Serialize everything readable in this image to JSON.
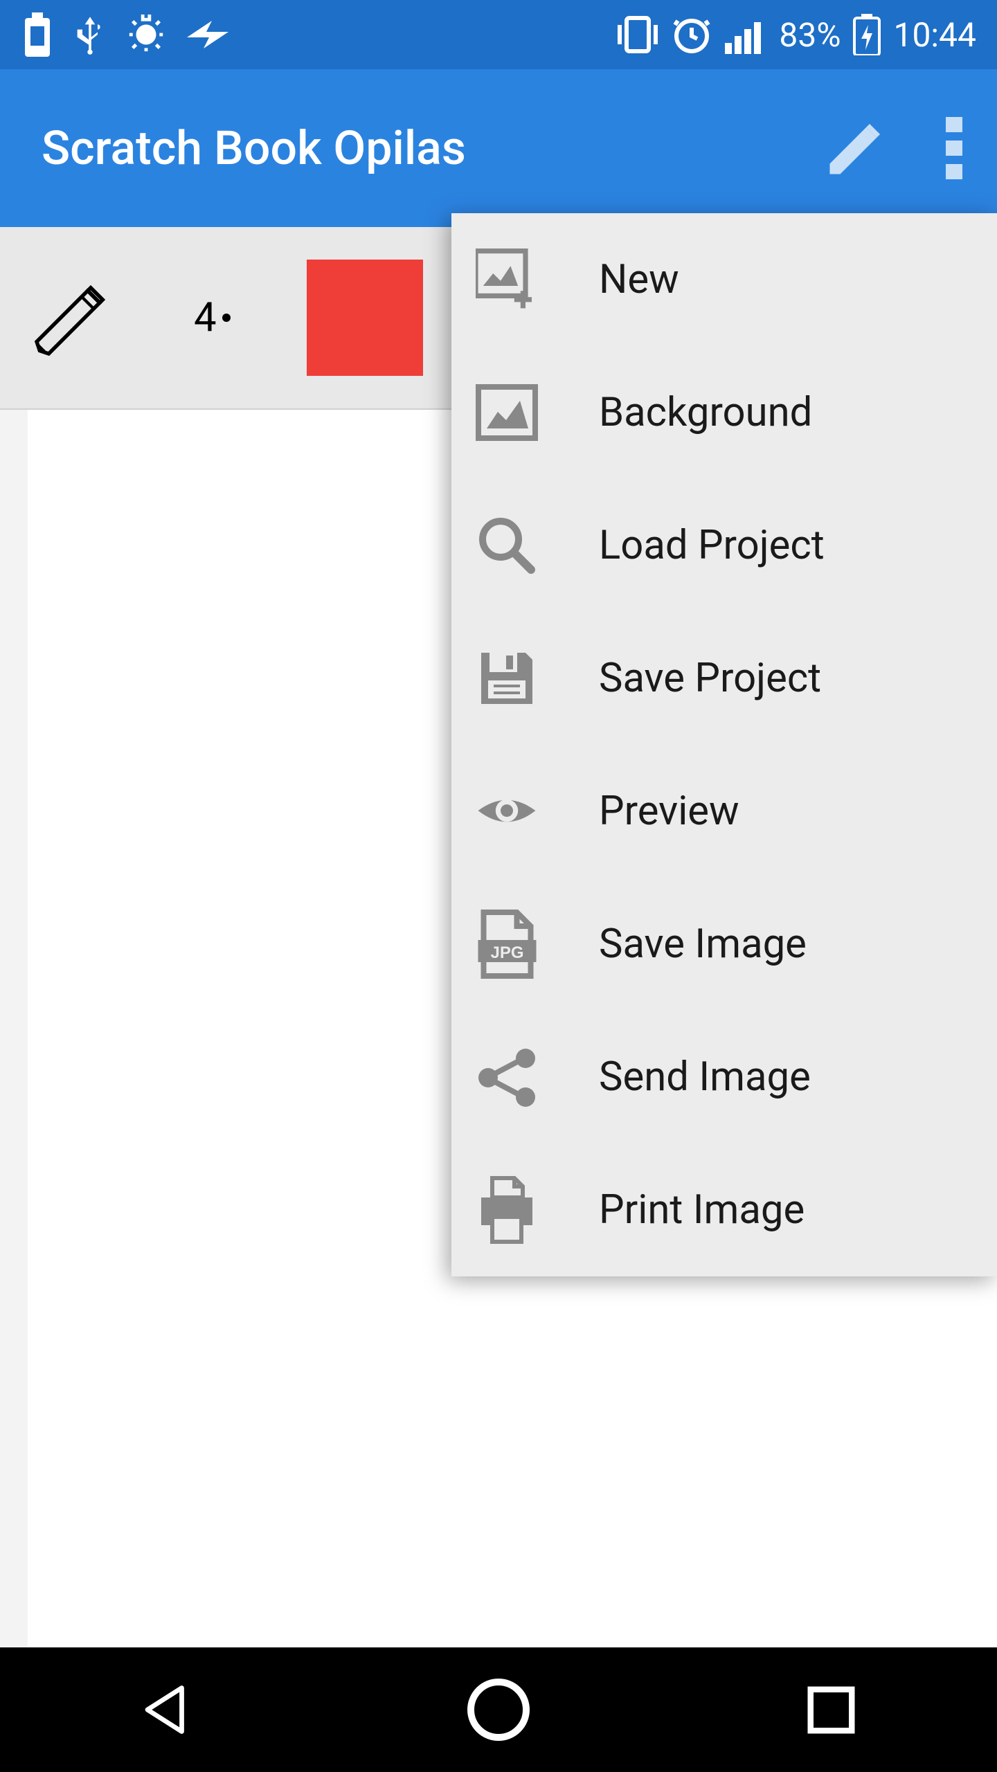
{
  "statusBar": {
    "battery": "83%",
    "time": "10:44"
  },
  "appBar": {
    "title": "Scratch Book Opilas"
  },
  "toolbar": {
    "brushSize": "4",
    "swatchColor": "#ef3d38"
  },
  "menu": {
    "items": [
      {
        "icon": "new-image-icon",
        "label": "New"
      },
      {
        "icon": "background-icon",
        "label": "Background"
      },
      {
        "icon": "search-icon",
        "label": "Load Project"
      },
      {
        "icon": "save-icon",
        "label": "Save Project"
      },
      {
        "icon": "eye-icon",
        "label": "Preview"
      },
      {
        "icon": "jpg-file-icon",
        "label": "Save Image"
      },
      {
        "icon": "share-icon",
        "label": "Send Image"
      },
      {
        "icon": "print-icon",
        "label": "Print Image"
      }
    ]
  }
}
